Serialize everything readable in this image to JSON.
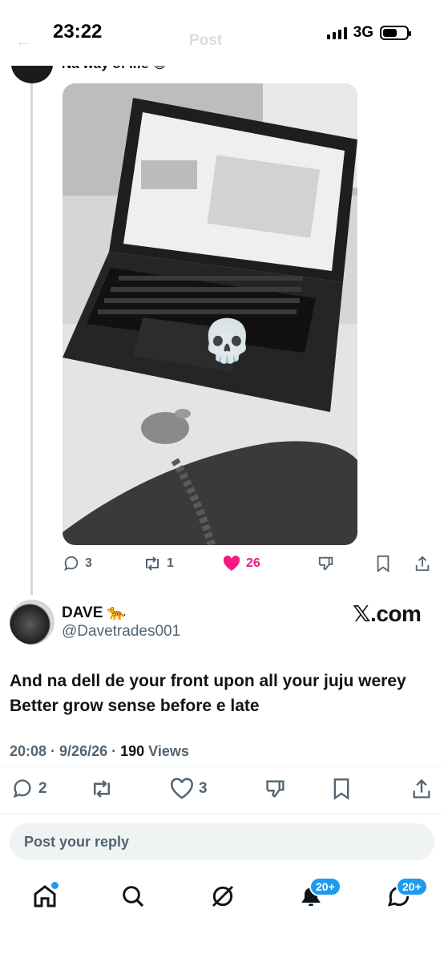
{
  "status_bar": {
    "time": "23:22",
    "network": "3G"
  },
  "header": {
    "back_icon": "arrow-left-icon",
    "title": "Post"
  },
  "previous_post": {
    "text_fragment": "Na way of life 😅",
    "image_overlay_emoji": "💀",
    "actions": {
      "replies": "3",
      "reposts": "1",
      "likes": "26",
      "like_color": "#f91880"
    }
  },
  "post": {
    "author_name": "DAVE 🐆",
    "author_handle": "@Davetrades001",
    "brand": "𝕏.com",
    "text_line1": "And na dell de your front upon all your juju werey",
    "text_line2": "Better grow sense before e late",
    "time": "20:08",
    "date": "9/26/26",
    "views_count": "190",
    "views_label": "Views",
    "actions": {
      "replies": "2",
      "reposts": "",
      "likes": "3"
    }
  },
  "reply": {
    "placeholder": "Post your reply"
  },
  "bottom_nav": {
    "notifications_badge": "20+",
    "messages_badge": "20+"
  },
  "colors": {
    "accent": "#1d9bf0",
    "muted": "#536471",
    "like": "#f91880"
  }
}
